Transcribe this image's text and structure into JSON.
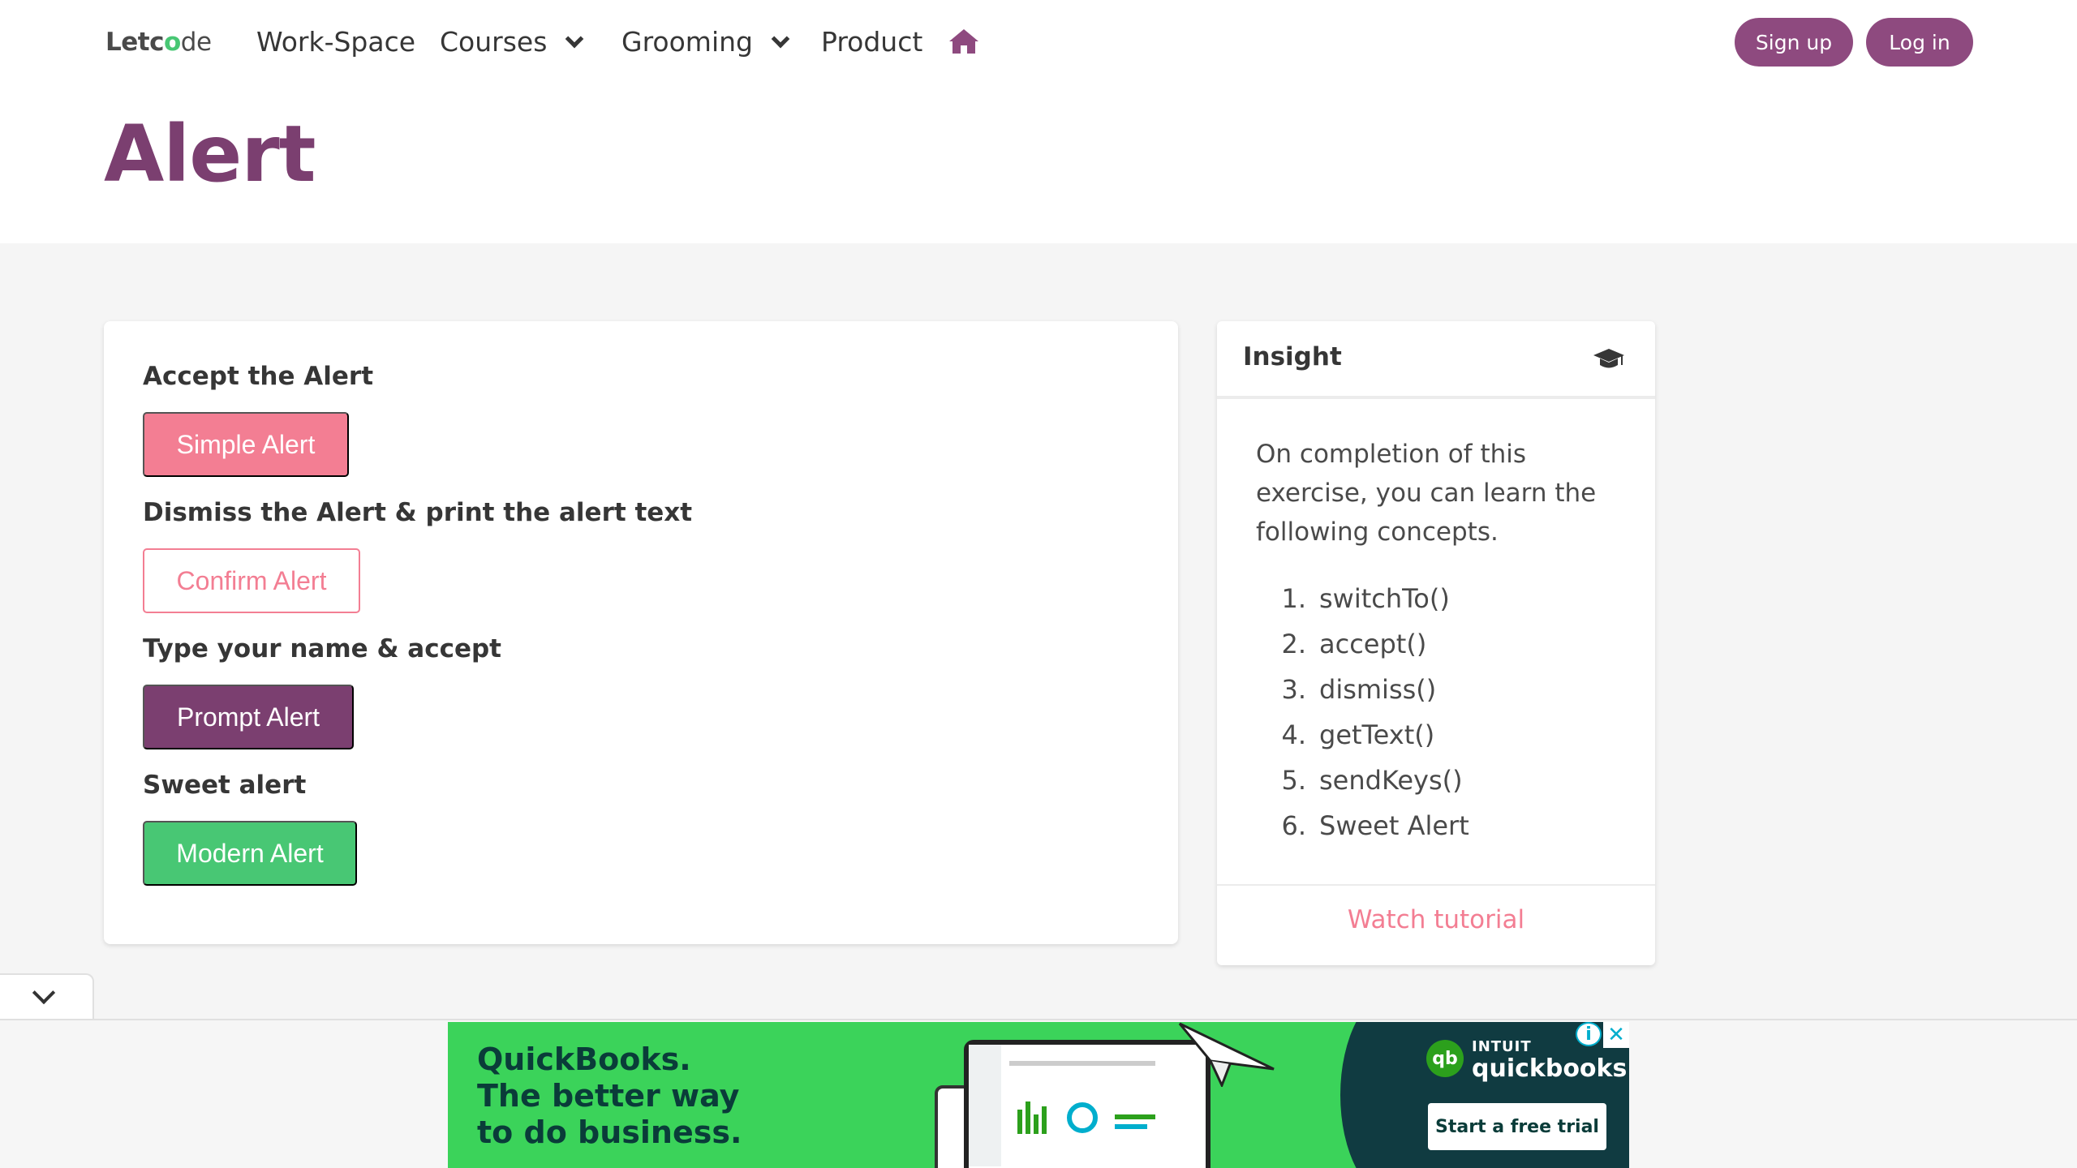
{
  "navbar": {
    "brand_prefix": "Letc",
    "brand_o": "o",
    "brand_suffix": "de",
    "workspace": "Work-Space",
    "courses": "Courses",
    "grooming": "Grooming",
    "product": "Product",
    "signup": "Sign up",
    "login": "Log in"
  },
  "page": {
    "title": "Alert"
  },
  "alerts": {
    "accept_label": "Accept the Alert",
    "simple_button": "Simple Alert",
    "dismiss_label": "Dismiss the Alert & print the alert text",
    "confirm_button": "Confirm Alert",
    "type_label": "Type your name & accept",
    "prompt_button": "Prompt Alert",
    "sweet_label": "Sweet alert",
    "modern_button": "Modern Alert"
  },
  "insight": {
    "title": "Insight",
    "description": "On completion of this exercise, you can learn the following concepts.",
    "concepts": [
      {
        "num": "1.",
        "text": "switchTo()"
      },
      {
        "num": "2.",
        "text": "accept()"
      },
      {
        "num": "3.",
        "text": "dismiss()"
      },
      {
        "num": "4.",
        "text": "getText()"
      },
      {
        "num": "5.",
        "text": "sendKeys()"
      },
      {
        "num": "6.",
        "text": "Sweet Alert"
      }
    ],
    "watch": "Watch tutorial"
  },
  "ad": {
    "line1": "QuickBooks.",
    "line2": "The better way",
    "line3": "to do business.",
    "intuit": "INTUIT",
    "brand": "quickbooks",
    "logo": "qb",
    "cta": "Start a free trial",
    "info": "i",
    "close": "✕"
  },
  "colors": {
    "accent": "#7b3f70",
    "pink": "#f37e93",
    "green": "#48c774"
  }
}
